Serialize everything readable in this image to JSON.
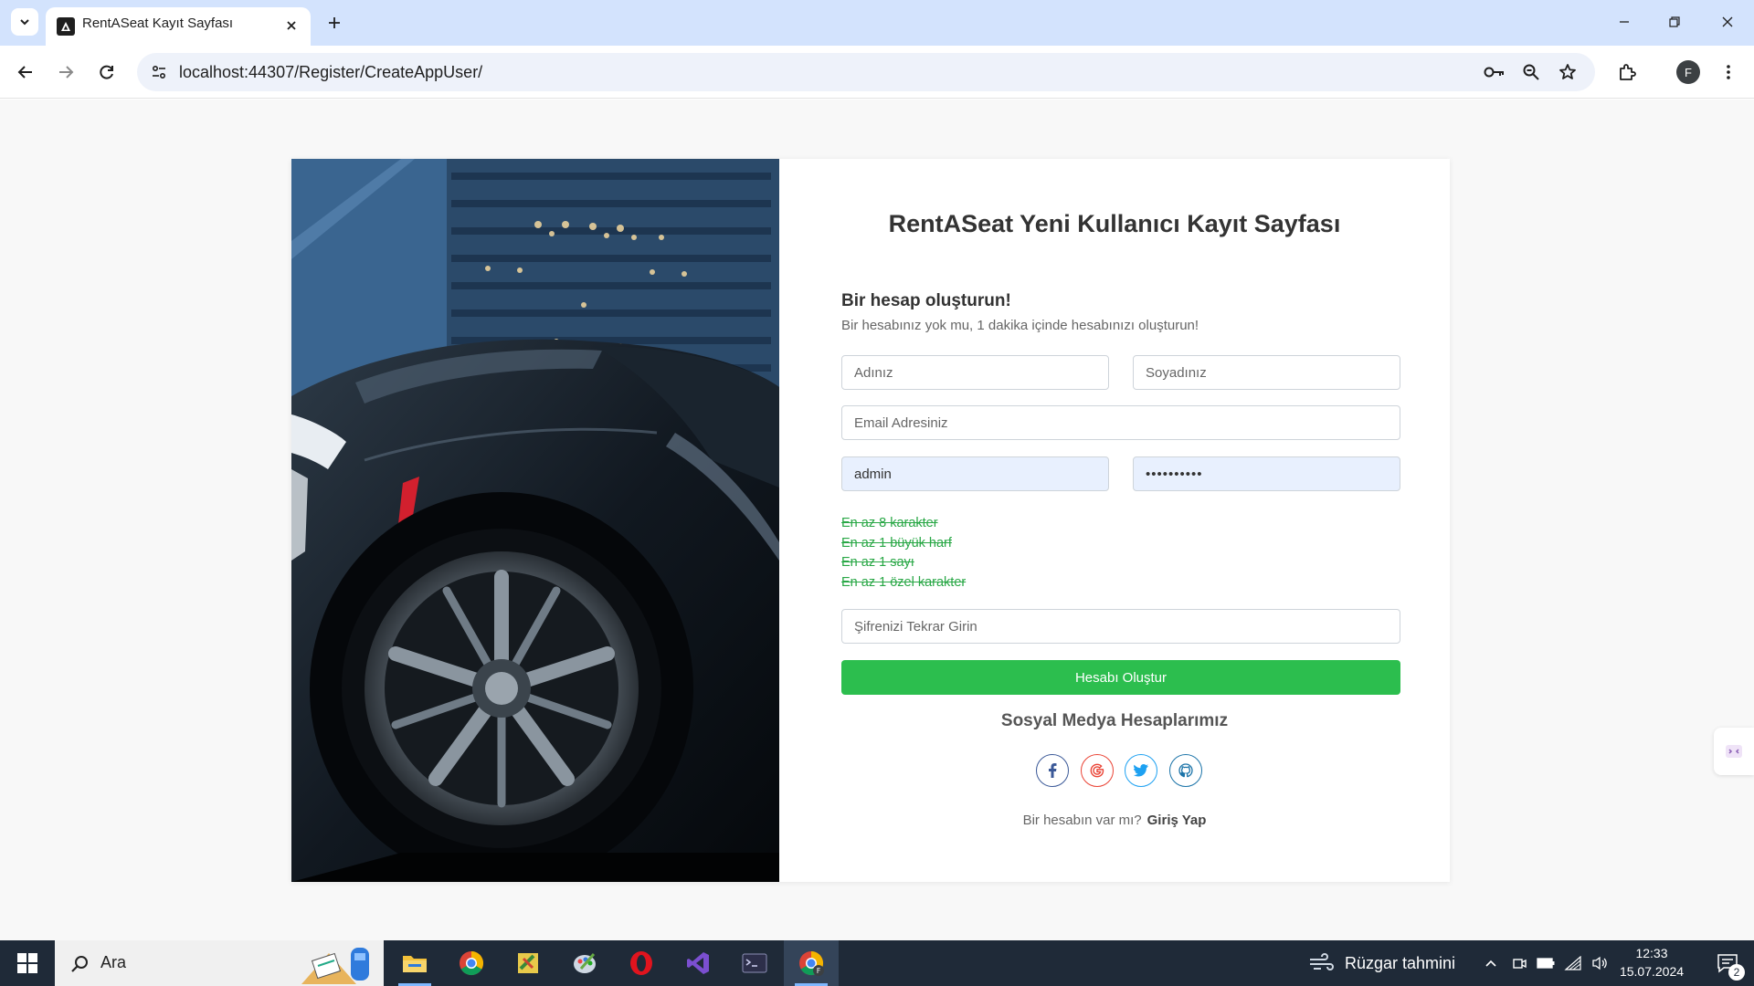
{
  "browser": {
    "tab_title": "RentASeat Kayıt Sayfası",
    "url": "localhost:44307/Register/CreateAppUser/",
    "profile_initial": "F"
  },
  "form": {
    "title": "RentASeat Yeni Kullanıcı Kayıt Sayfası",
    "subtitle": "Bir hesap oluşturun!",
    "description": "Bir hesabınız yok mu, 1 dakika içinde hesabınızı oluşturun!",
    "first_name_placeholder": "Adınız",
    "last_name_placeholder": "Soyadınız",
    "email_placeholder": "Email Adresiniz",
    "username_value": "admin",
    "password_value": "••••••••••",
    "password_rules": [
      "En az 8 karakter",
      "En az 1 büyük harf",
      "En az 1 sayı",
      "En az 1 özel karakter"
    ],
    "confirm_password_placeholder": "Şifrenizi Tekrar Girin",
    "submit_label": "Hesabı Oluştur",
    "social_title": "Sosyal Medya Hesaplarımız",
    "have_account_text": "Bir hesabın var mı?",
    "login_link": "Giriş Yap"
  },
  "colors": {
    "submit": "#2cbe4e",
    "rule_ok": "#28a745",
    "facebook": "#3b5998",
    "google": "#ea4335",
    "twitter": "#1da1f2",
    "github": "#1a73a8"
  },
  "social_icons": [
    "facebook-icon",
    "google-icon",
    "twitter-icon",
    "github-icon"
  ],
  "taskbar": {
    "search_label": "Ara",
    "weather": "Rüzgar tahmini",
    "time": "12:33",
    "date": "15.07.2024",
    "notification_count": "2"
  }
}
